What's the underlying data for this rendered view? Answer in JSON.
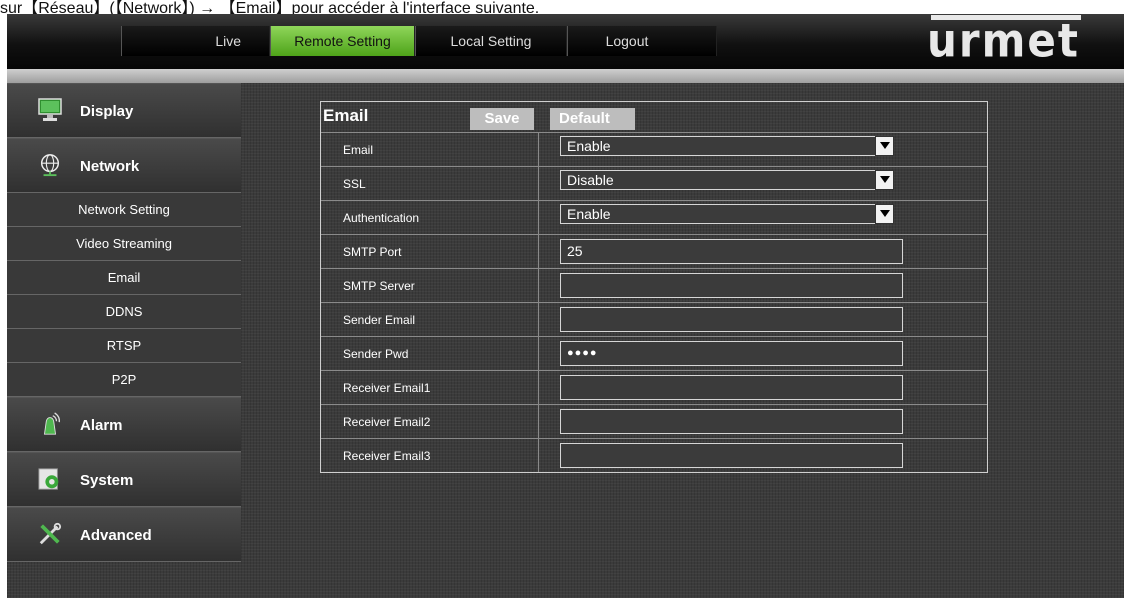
{
  "caption": "sur【Réseau】(【Network】) → 【Email】pour accéder à l'interface suivante.",
  "top_nav": {
    "tabs": [
      {
        "label": "Live"
      },
      {
        "label": "Remote Setting"
      },
      {
        "label": "Local Setting"
      },
      {
        "label": "Logout"
      }
    ],
    "active_tab": "Remote Setting",
    "logo": "urmet"
  },
  "sidebar": {
    "display": {
      "label": "Display",
      "icon": "monitor-icon"
    },
    "network": {
      "label": "Network",
      "icon": "globe-icon"
    },
    "network_items": [
      {
        "label": "Network Setting"
      },
      {
        "label": "Video Streaming"
      },
      {
        "label": "Email"
      },
      {
        "label": "DDNS"
      },
      {
        "label": "RTSP"
      },
      {
        "label": "P2P"
      }
    ],
    "alarm": {
      "label": "Alarm",
      "icon": "alarm-icon"
    },
    "system": {
      "label": "System",
      "icon": "system-gear-icon"
    },
    "advanced": {
      "label": "Advanced",
      "icon": "tools-icon"
    }
  },
  "panel": {
    "title": "Email",
    "save_label": "Save",
    "default_label": "Default",
    "fields": {
      "email": {
        "label": "Email",
        "value": "Enable"
      },
      "ssl": {
        "label": "SSL",
        "value": "Disable"
      },
      "authentication": {
        "label": "Authentication",
        "value": "Enable"
      },
      "smtp_port": {
        "label": "SMTP Port",
        "value": "25"
      },
      "smtp_server": {
        "label": "SMTP Server",
        "value": ""
      },
      "sender_email": {
        "label": "Sender Email",
        "value": ""
      },
      "sender_pwd": {
        "label": "Sender Pwd",
        "value": "●●●●"
      },
      "receiver_email1": {
        "label": "Receiver Email1",
        "value": ""
      },
      "receiver_email2": {
        "label": "Receiver Email2",
        "value": ""
      },
      "receiver_email3": {
        "label": "Receiver Email3",
        "value": ""
      }
    }
  },
  "colors": {
    "active_tab": "#6cc03a",
    "background": "#3b3b3b",
    "button": "#bdbdbd"
  }
}
